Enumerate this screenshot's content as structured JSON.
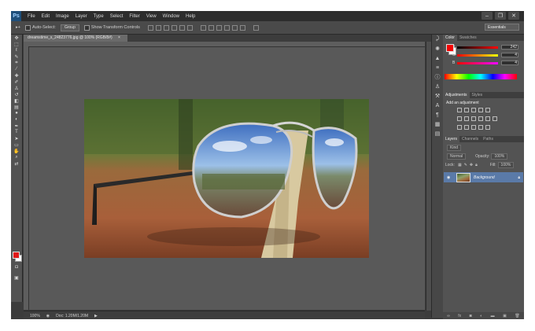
{
  "app": {
    "logo": "Ps"
  },
  "menu": [
    "File",
    "Edit",
    "Image",
    "Layer",
    "Type",
    "Select",
    "Filter",
    "View",
    "Window",
    "Help"
  ],
  "window_controls": [
    "–",
    "❐",
    "✕"
  ],
  "options": {
    "auto_select": "Auto-Select:",
    "group_value": "Group",
    "show_transform": "Show Transform Controls",
    "workspace": "Essentials"
  },
  "document": {
    "tab_title": "dreamstime_s_24823776.jpg @ 100% (RGB/8#)",
    "tab_close": "×"
  },
  "status": {
    "zoom": "100%",
    "doc_size": "Doc: 1.20M/1.20M"
  },
  "color_panel": {
    "tabs": [
      "Color",
      "Swatches"
    ],
    "r_label": "R",
    "r_value": "242",
    "g_label": "G",
    "g_value": "4",
    "b_label": "B",
    "b_value": "4",
    "foreground": "#f20404"
  },
  "adjustments_panel": {
    "tabs": [
      "Adjustments",
      "Styles"
    ],
    "title": "Add an adjustment"
  },
  "layers_panel": {
    "tabs": [
      "Layers",
      "Channels",
      "Paths"
    ],
    "kind_label": "Kind",
    "blend_mode": "Normal",
    "opacity_label": "Opacity:",
    "opacity_value": "100%",
    "lock_label": "Lock:",
    "fill_label": "Fill:",
    "fill_value": "100%",
    "layer_name": "Background"
  },
  "icons": [
    "move-tool-icon",
    "marquee-tool-icon",
    "lasso-tool-icon",
    "quick-select-icon",
    "crop-tool-icon",
    "eyedropper-icon",
    "healing-brush-icon",
    "brush-tool-icon",
    "clone-stamp-icon",
    "history-brush-icon",
    "eraser-icon",
    "gradient-icon",
    "blur-icon",
    "dodge-icon",
    "pen-tool-icon",
    "type-tool-icon",
    "path-select-icon",
    "shape-tool-icon",
    "hand-tool-icon",
    "zoom-tool-icon"
  ]
}
